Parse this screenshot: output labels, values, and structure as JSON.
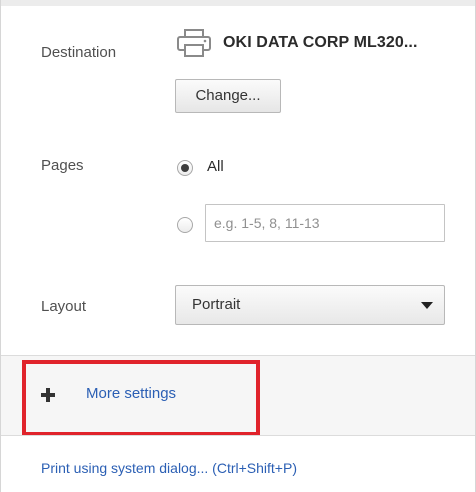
{
  "destination": {
    "label": "Destination",
    "printer_icon": "printer-icon",
    "printer_name": "OKI DATA CORP ML320...",
    "change_button": "Change..."
  },
  "pages": {
    "label": "Pages",
    "all_label": "All",
    "all_selected": true,
    "range_placeholder": "e.g. 1-5, 8, 11-13",
    "range_value": ""
  },
  "layout": {
    "label": "Layout",
    "selected": "Portrait",
    "dropdown_icon": "chevron-down-icon"
  },
  "more_settings": {
    "icon": "plus-icon",
    "label": "More settings",
    "highlight_color": "#e0232b"
  },
  "system_dialog": {
    "label": "Print using system dialog... (Ctrl+Shift+P)"
  },
  "colors": {
    "link": "#2b5fb4",
    "highlight": "#e0232b"
  }
}
